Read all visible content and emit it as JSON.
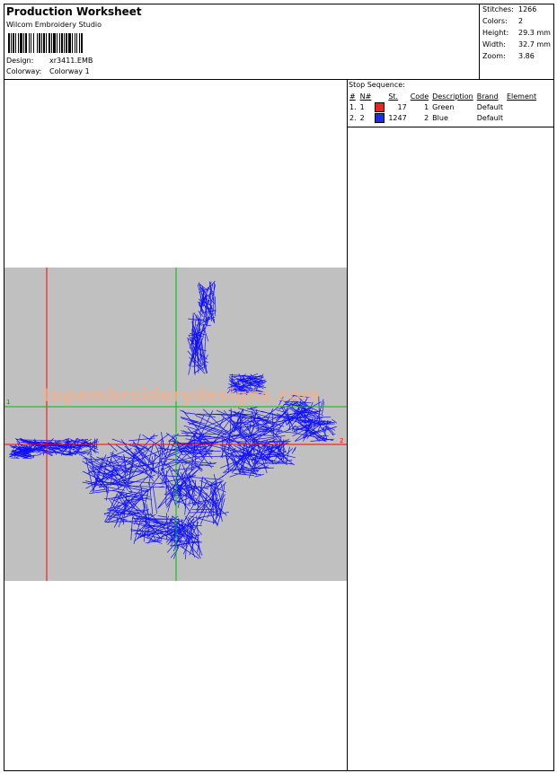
{
  "header": {
    "title": "Production Worksheet",
    "software": "Wilcom  Embroidery Studio",
    "design_label": "Design:",
    "design_value": "xr3411.EMB",
    "colorway_label": "Colorway:",
    "colorway_value": "Colorway 1"
  },
  "stats": [
    {
      "label": "Stitches:",
      "value": "1266"
    },
    {
      "label": "Colors:",
      "value": "2"
    },
    {
      "label": "Height:",
      "value": "29.3 mm"
    },
    {
      "label": "Width:",
      "value": "32.7 mm"
    },
    {
      "label": "Zoom:",
      "value": "3.86"
    }
  ],
  "watermark": "topembroiderydesigns.com",
  "axis_marks": {
    "left": "1",
    "right": "2"
  },
  "stop_sequence": {
    "title": "Stop Sequence:",
    "columns": [
      "#",
      "N#",
      "St.",
      "Code",
      "Description",
      "Brand",
      "Element"
    ],
    "rows": [
      {
        "num": "1.",
        "n": "1",
        "color": "#e8281e",
        "stitches": "17",
        "code": "1",
        "description": "Green",
        "brand": "Default",
        "element": ""
      },
      {
        "num": "2.",
        "n": "2",
        "color": "#1a2cf0",
        "stitches": "1247",
        "code": "2",
        "description": "Blue",
        "brand": "Default",
        "element": ""
      }
    ]
  },
  "colors": {
    "stitch": "#1010ff",
    "red_guide": "#ff0000",
    "green_guide": "#00c000",
    "canvas": "#c0c0c0"
  }
}
